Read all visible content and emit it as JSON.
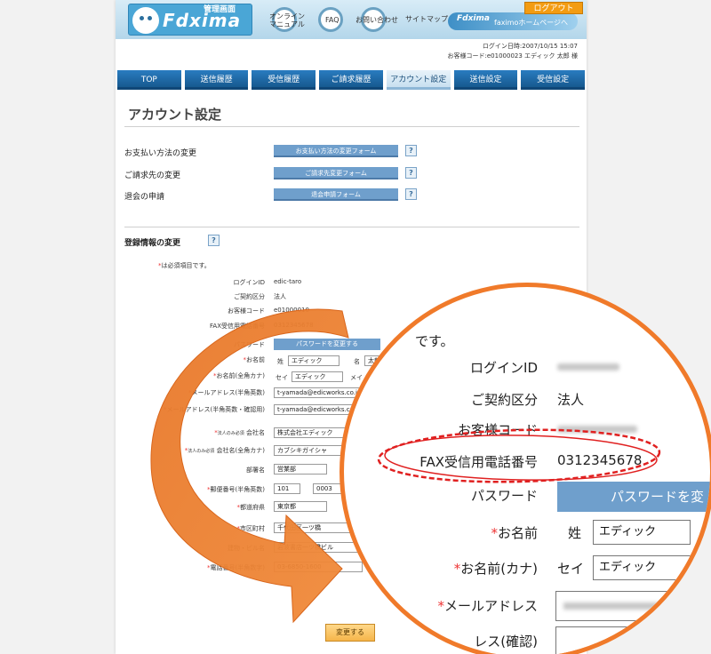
{
  "header": {
    "logo_text": "Fdxima",
    "logo_sub": "管理画面",
    "links": [
      "オンライン\nマニュアル",
      "FAQ",
      "お問い合わせ"
    ],
    "sitemap": "サイトマップ",
    "home_logo": "Fdxima",
    "home_label": "faximoホームページへ",
    "logout": "ログアウト",
    "login_time": "ログイン日時:2007/10/15  15:07",
    "customer": "お客様コード:e01000023   エディック  太郎  様"
  },
  "nav": [
    "TOP",
    "送信履歴",
    "受信履歴",
    "ご請求履歴",
    "アカウント設定",
    "送信設定",
    "受信設定"
  ],
  "page_title": "アカウント設定",
  "actions": [
    {
      "label": "お支払い方法の変更",
      "button": "お支払い方法の変更フォーム"
    },
    {
      "label": "ご請求先の変更",
      "button": "ご請求先変更フォーム"
    },
    {
      "label": "退会の申請",
      "button": "退会申請フォーム"
    }
  ],
  "help_mark": "?",
  "registration": {
    "title": "登録情報の変更",
    "required_mark": "*",
    "required_note": "は必須項目です。",
    "corp_only": "法人のみ必須",
    "labels": {
      "login_id": "ログインID",
      "contract": "ご契約区分",
      "customer_code": "お客様コード",
      "fax_number": "FAX受信用電話番号",
      "password": "パスワード",
      "name": "お名前",
      "name_kana": "お名前(全角カナ)",
      "email": "メールアドレス(半角英数)",
      "email_confirm": "メールアドレス(半角英数・確認用)",
      "company": "会社名",
      "company_kana": "会社名(全角カナ)",
      "dept": "部署名",
      "zip": "郵便番号(半角英数)",
      "pref": "都道府県",
      "city": "市区町村",
      "building": "建物・ビル名",
      "phone": "電話番号(半角数字)"
    },
    "values": {
      "login_id": "edic-taro",
      "contract": "法人",
      "customer_code": "e01000010",
      "fax_number": "0312345678",
      "password_button": "パスワードを変更する",
      "sei_label": "姓",
      "mei_label": "名",
      "sei_kana_label": "セイ",
      "mei_kana_label": "メイ",
      "last_name": "エディック",
      "first_name": "太郎",
      "last_name_kana": "エディック",
      "email": "t-yamada@edicworks.co.jp",
      "email_confirm": "t-yamada@edicworks.co.jp",
      "company": "株式会社エディック",
      "company_kana": "カブシキガイシャ",
      "dept": "営業部",
      "zip1": "101",
      "zip2": "0003",
      "pref": "東京都",
      "city": "千代田区一ツ橋",
      "building": "岩波書店一ツ橋ビル",
      "phone": "03-6850-1600"
    },
    "submit": "変更する"
  },
  "zoom": {
    "note": "です。",
    "labels": {
      "login_id": "ログインID",
      "contract": "ご契約区分",
      "customer_code": "お客様コード",
      "fax_number": "FAX受信用電話番号",
      "password": "パスワード",
      "name": "お名前",
      "name_kana": "お名前(カナ)",
      "email": "メールアドレス",
      "email_confirm": "レス(確認)"
    },
    "values": {
      "contract": "法人",
      "fax_number": "0312345678",
      "password_button": "パスワードを変",
      "sei_label": "姓",
      "last_name": "エディック",
      "sei_kana_label": "セイ",
      "last_name_kana": "エディック"
    }
  },
  "colors": {
    "nav": "#1f6ba8",
    "button": "#6f9fcc",
    "accent_orange": "#f07a2a",
    "highlight_red": "#e02020"
  }
}
